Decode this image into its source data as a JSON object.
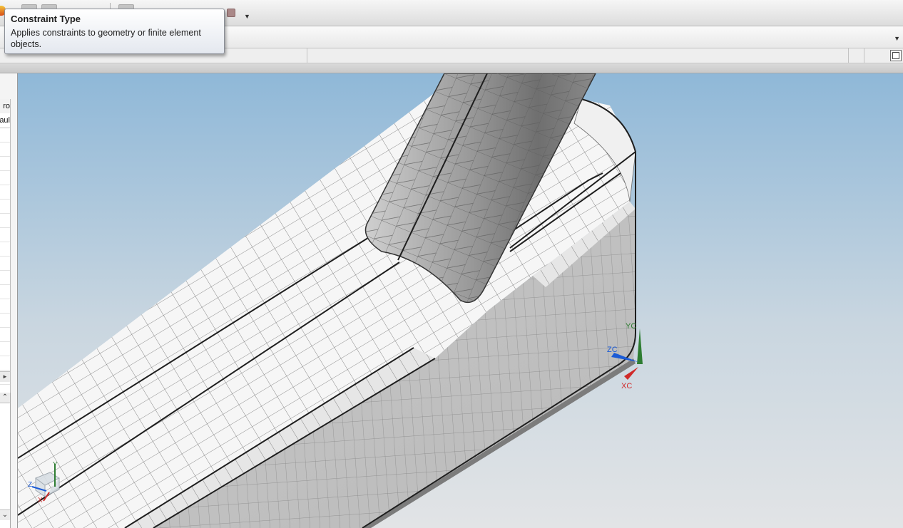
{
  "tooltip": {
    "title": "Constraint Type",
    "body": "Applies constraints to geometry or finite element objects."
  },
  "navigator": {
    "header_1": "ro",
    "header_2": "aul"
  },
  "triad_main": {
    "x_label": "XC",
    "y_label": "YC",
    "z_label": "ZC"
  },
  "triad_corner": {
    "x_label": "X",
    "y_label": "Y",
    "z_label": "Z"
  },
  "colors": {
    "bg_top": "#8fb8d8",
    "bg_bottom": "#e2e4e6",
    "mesh_top_face": "#f4f4f4",
    "mesh_side_face": "#b9b9b9",
    "mesh_lines": "#6d6d6d",
    "feature_edges": "#1e1e1e",
    "axis_x": "#d02a2a",
    "axis_y": "#2e7d32",
    "axis_z": "#1b5bd6"
  },
  "icons": [
    "nx-logo-icon",
    "dropdown-arrow-icon",
    "maximize-view-icon",
    "scroll-right-icon",
    "scroll-up-icon",
    "scroll-down-icon",
    "view-triad-icon"
  ]
}
